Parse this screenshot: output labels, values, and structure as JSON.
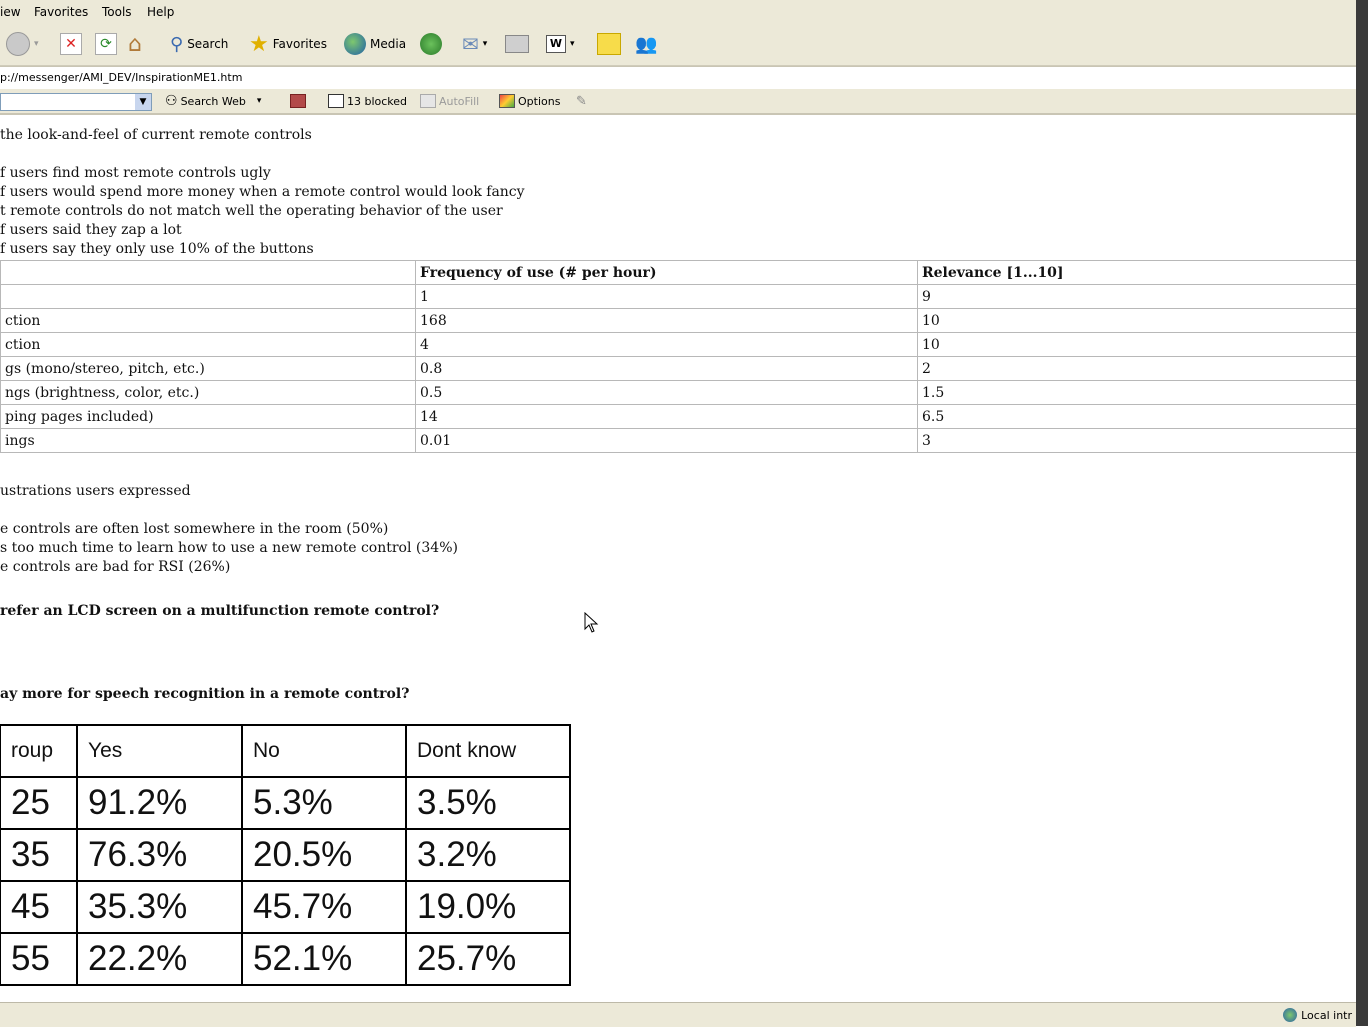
{
  "menubar": {
    "items": [
      "iew",
      "Favorites",
      "Tools",
      "Help"
    ]
  },
  "toolbar": {
    "search_label": "Search",
    "favorites_label": "Favorites",
    "media_label": "Media"
  },
  "address": {
    "url": "p://messenger/AMI_DEV/InspirationME1.htm"
  },
  "linksbar": {
    "search_web_label": "Search Web",
    "blocked_label": "13 blocked",
    "autofill_label": "AutoFill",
    "options_label": "Options"
  },
  "content": {
    "intro": "the look-and-feel of current remote controls",
    "findings": [
      "f users find most remote controls ugly",
      "f users would spend more money when a remote control would look fancy",
      "t remote controls do not match well the operating behavior of the user",
      "f users said they zap a lot",
      "f users say they only use 10% of the buttons"
    ],
    "freq_table": {
      "headers": [
        "",
        "Frequency of use (# per hour)",
        "Relevance [1...10]"
      ],
      "rows": [
        [
          "",
          "1",
          "9"
        ],
        [
          "ction",
          "168",
          "10"
        ],
        [
          "ction",
          "4",
          "10"
        ],
        [
          "gs (mono/stereo, pitch, etc.)",
          "0.8",
          "2"
        ],
        [
          "ngs (brightness, color, etc.)",
          "0.5",
          "1.5"
        ],
        [
          "ping pages included)",
          "14",
          "6.5"
        ],
        [
          "ings",
          "0.01",
          "3"
        ]
      ]
    },
    "frustrations_heading": "ustrations users expressed",
    "frustrations": [
      "e controls are often lost somewhere in the room (50%)",
      "s too much time to learn how to use a new remote control (34%)",
      "e controls are bad for RSI (26%)"
    ],
    "question_lcd": "refer an LCD screen on a multifunction remote control?",
    "question_speech": "ay more for speech recognition in a remote control?",
    "age_table": {
      "headers": [
        "roup",
        "Yes",
        "No",
        "Dont know"
      ],
      "rows": [
        [
          "25",
          "91.2%",
          "5.3%",
          "3.5%"
        ],
        [
          "35",
          "76.3%",
          "20.5%",
          "3.2%"
        ],
        [
          "45",
          "35.3%",
          "45.7%",
          "19.0%"
        ],
        [
          "55",
          "22.2%",
          "52.1%",
          "25.7%"
        ]
      ]
    }
  },
  "statusbar": {
    "zone_label": "Local intr"
  }
}
